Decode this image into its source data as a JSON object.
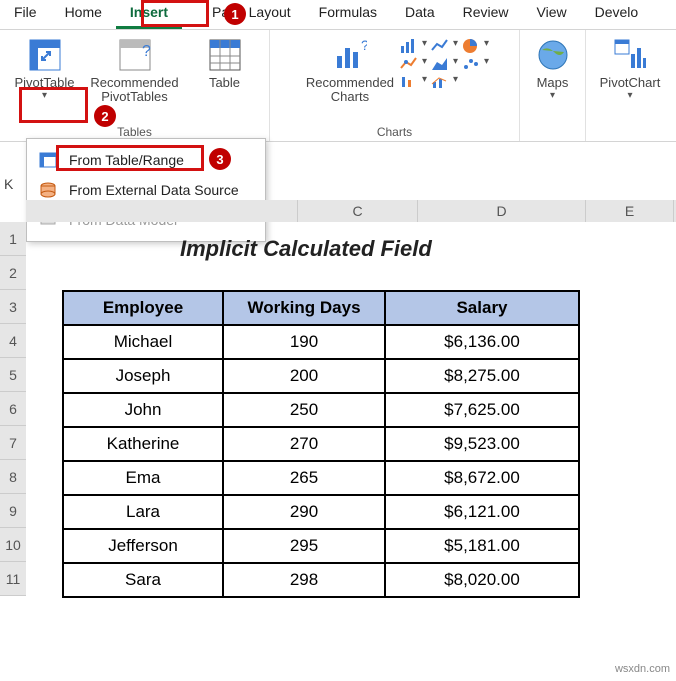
{
  "tabs": [
    "File",
    "Home",
    "Insert",
    "Page Layout",
    "Formulas",
    "Data",
    "Review",
    "View",
    "Develo"
  ],
  "active_tab": "Insert",
  "ribbon": {
    "pivot": "PivotTable",
    "recpivot": "Recommended\nPivotTables",
    "table": "Table",
    "reccharts": "Recommended\nCharts",
    "maps": "Maps",
    "pivotchart": "PivotChart",
    "grp_tables": "Tables",
    "grp_charts": "Charts"
  },
  "dropdown": {
    "range": "From Table/Range",
    "external": "From External Data Source",
    "model": "From Data Model"
  },
  "namebox": "K",
  "col_headers": [
    "C",
    "D",
    "E"
  ],
  "row_numbers": [
    "1",
    "2",
    "3",
    "4",
    "5",
    "6",
    "7",
    "8",
    "9",
    "10",
    "11"
  ],
  "title": "Implicit Calculated Field",
  "badges": {
    "b1": "1",
    "b2": "2",
    "b3": "3"
  },
  "table": {
    "headers": [
      "Employee",
      "Working Days",
      "Salary"
    ],
    "rows": [
      [
        "Michael",
        "190",
        "$6,136.00"
      ],
      [
        "Joseph",
        "200",
        "$8,275.00"
      ],
      [
        "John",
        "250",
        "$7,625.00"
      ],
      [
        "Katherine",
        "270",
        "$9,523.00"
      ],
      [
        "Ema",
        "265",
        "$8,672.00"
      ],
      [
        "Lara",
        "290",
        "$6,121.00"
      ],
      [
        "Jefferson",
        "295",
        "$5,181.00"
      ],
      [
        "Sara",
        "298",
        "$8,020.00"
      ]
    ]
  },
  "chart_data": {
    "type": "table",
    "title": "Implicit Calculated Field",
    "columns": [
      "Employee",
      "Working Days",
      "Salary"
    ],
    "rows": [
      {
        "Employee": "Michael",
        "Working Days": 190,
        "Salary": 6136.0
      },
      {
        "Employee": "Joseph",
        "Working Days": 200,
        "Salary": 8275.0
      },
      {
        "Employee": "John",
        "Working Days": 250,
        "Salary": 7625.0
      },
      {
        "Employee": "Katherine",
        "Working Days": 270,
        "Salary": 9523.0
      },
      {
        "Employee": "Ema",
        "Working Days": 265,
        "Salary": 8672.0
      },
      {
        "Employee": "Lara",
        "Working Days": 290,
        "Salary": 6121.0
      },
      {
        "Employee": "Jefferson",
        "Working Days": 295,
        "Salary": 5181.0
      },
      {
        "Employee": "Sara",
        "Working Days": 298,
        "Salary": 8020.0
      }
    ]
  },
  "watermark": "wsxdn.com"
}
